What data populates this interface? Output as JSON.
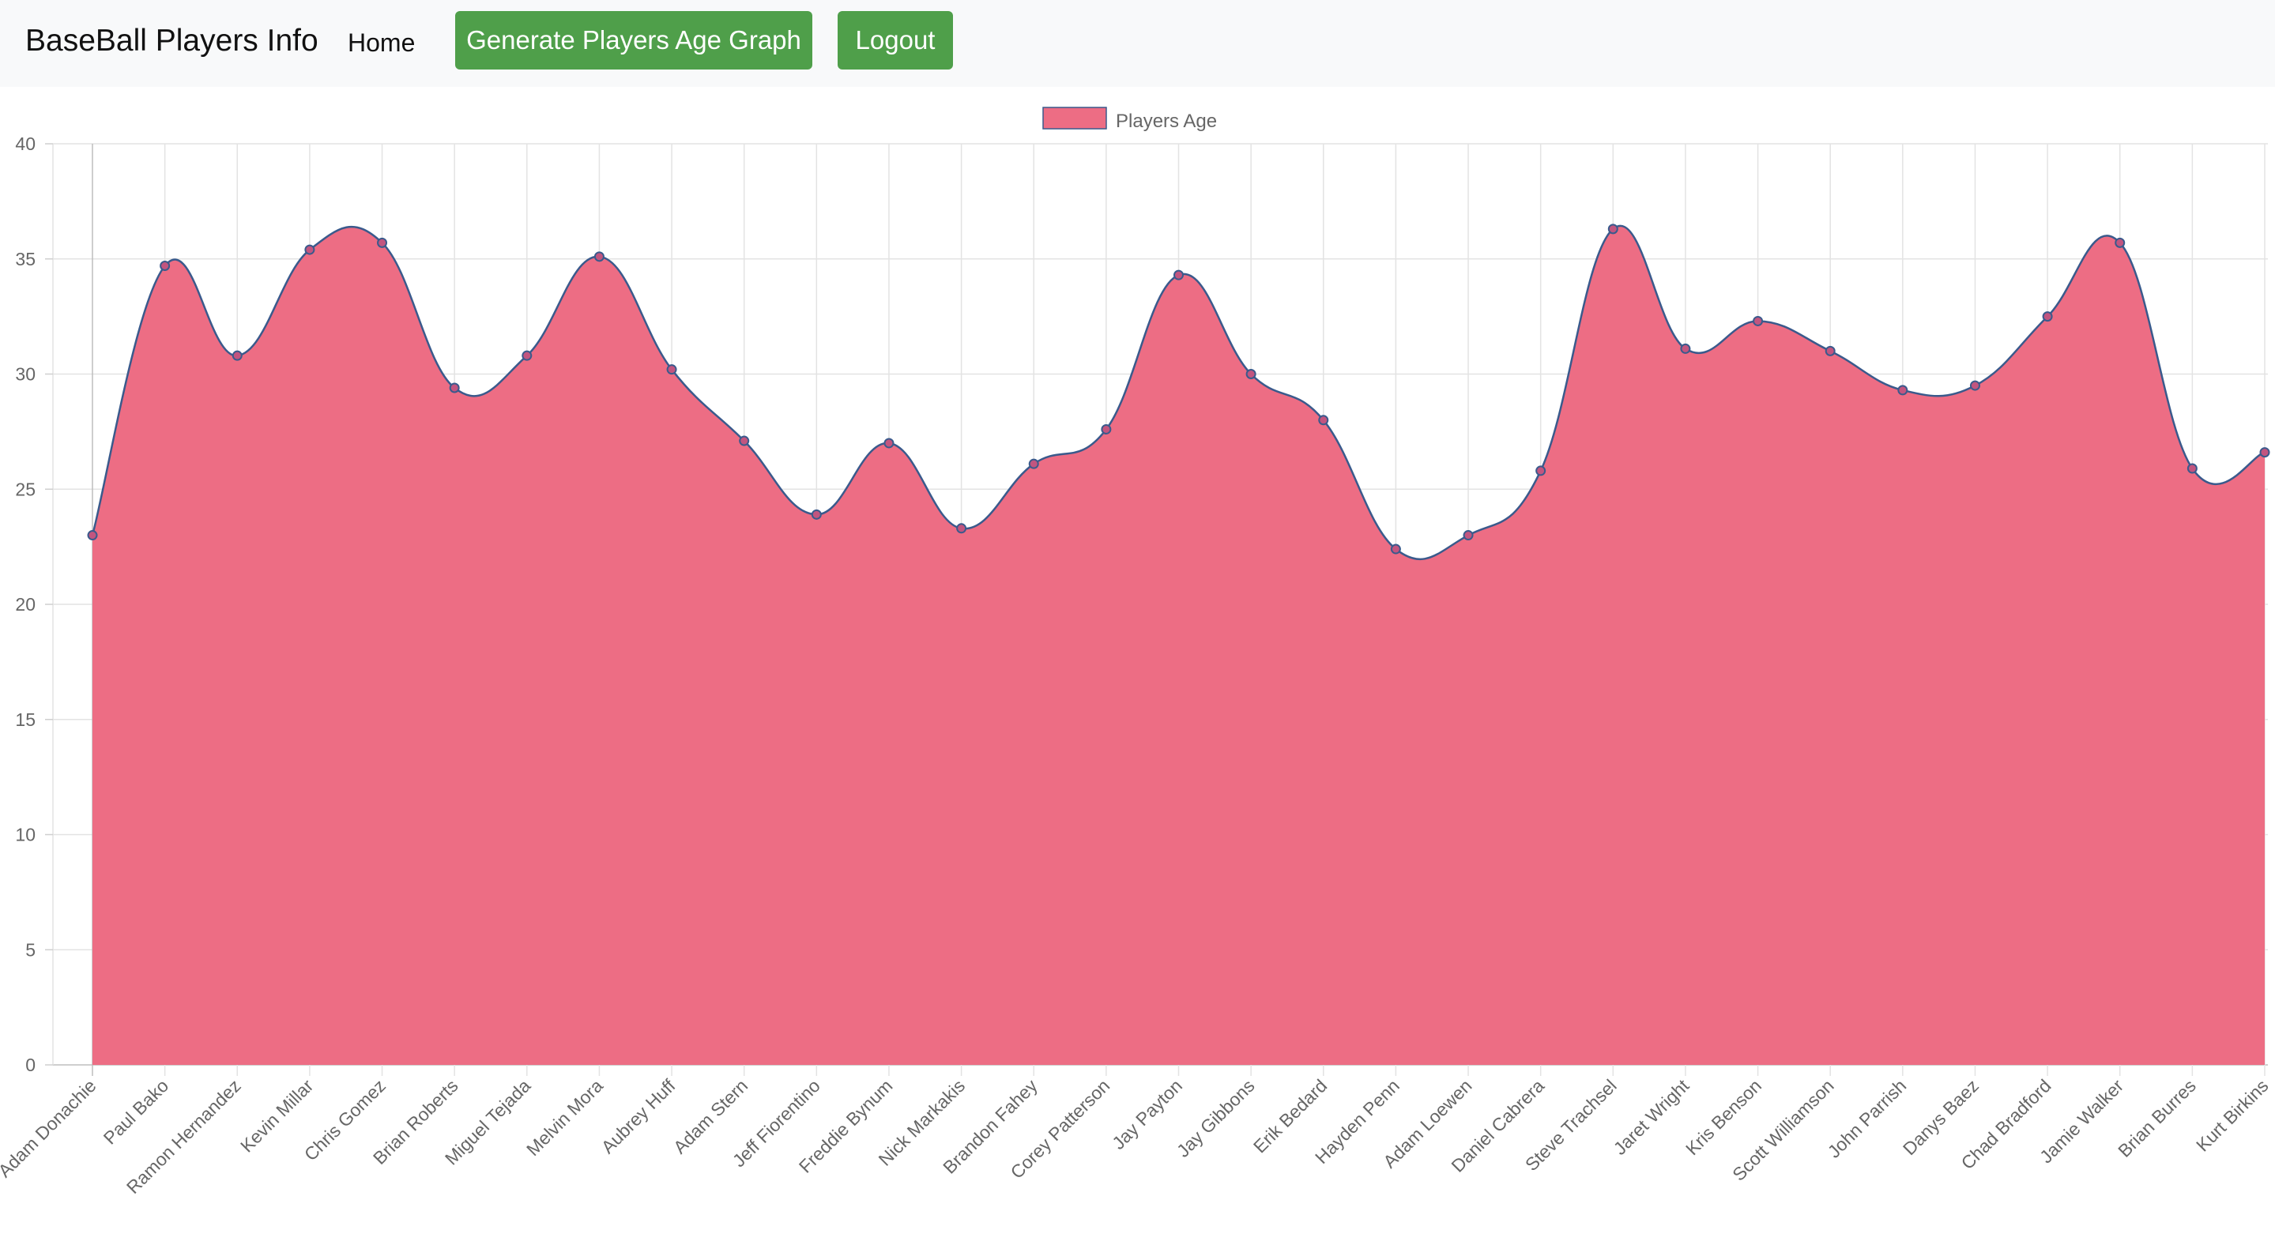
{
  "navbar": {
    "brand": "BaseBall Players Info",
    "home_label": "Home",
    "generate_graph_label": "Generate Players Age Graph",
    "logout_label": "Logout"
  },
  "colors": {
    "navbar_bg": "#f8f9fa",
    "button_green": "#4f9f4a",
    "area_fill": "#ed6d84",
    "line_stroke": "#3a5a8c",
    "grid": "#e3e3e3"
  },
  "chart_data": {
    "type": "area",
    "title": "",
    "xlabel": "",
    "ylabel": "",
    "ylim": [
      0,
      40
    ],
    "yticks": [
      0,
      5,
      10,
      15,
      20,
      25,
      30,
      35,
      40
    ],
    "grid": true,
    "legend_position": "top-center",
    "categories": [
      "Adam Donachie",
      "Paul Bako",
      "Ramon Hernandez",
      "Kevin Millar",
      "Chris Gomez",
      "Brian Roberts",
      "Miguel Tejada",
      "Melvin Mora",
      "Aubrey Huff",
      "Adam Stern",
      "Jeff Fiorentino",
      "Freddie Bynum",
      "Nick Markakis",
      "Brandon Fahey",
      "Corey Patterson",
      "Jay Payton",
      "Jay Gibbons",
      "Erik Bedard",
      "Hayden Penn",
      "Adam Loewen",
      "Daniel Cabrera",
      "Steve Trachsel",
      "Jaret Wright",
      "Kris Benson",
      "Scott Williamson",
      "John Parrish",
      "Danys Baez",
      "Chad Bradford",
      "Jamie Walker",
      "Brian Burres",
      "Kurt Birkins"
    ],
    "series": [
      {
        "name": "Players Age",
        "values": [
          23.0,
          34.7,
          30.8,
          35.4,
          35.7,
          29.4,
          30.8,
          35.1,
          30.2,
          27.1,
          23.9,
          27.0,
          23.3,
          26.1,
          27.6,
          34.3,
          30.0,
          28.0,
          22.4,
          23.0,
          25.8,
          36.3,
          31.1,
          32.3,
          31.0,
          29.3,
          29.5,
          32.5,
          35.7,
          25.9,
          26.6
        ]
      }
    ]
  }
}
